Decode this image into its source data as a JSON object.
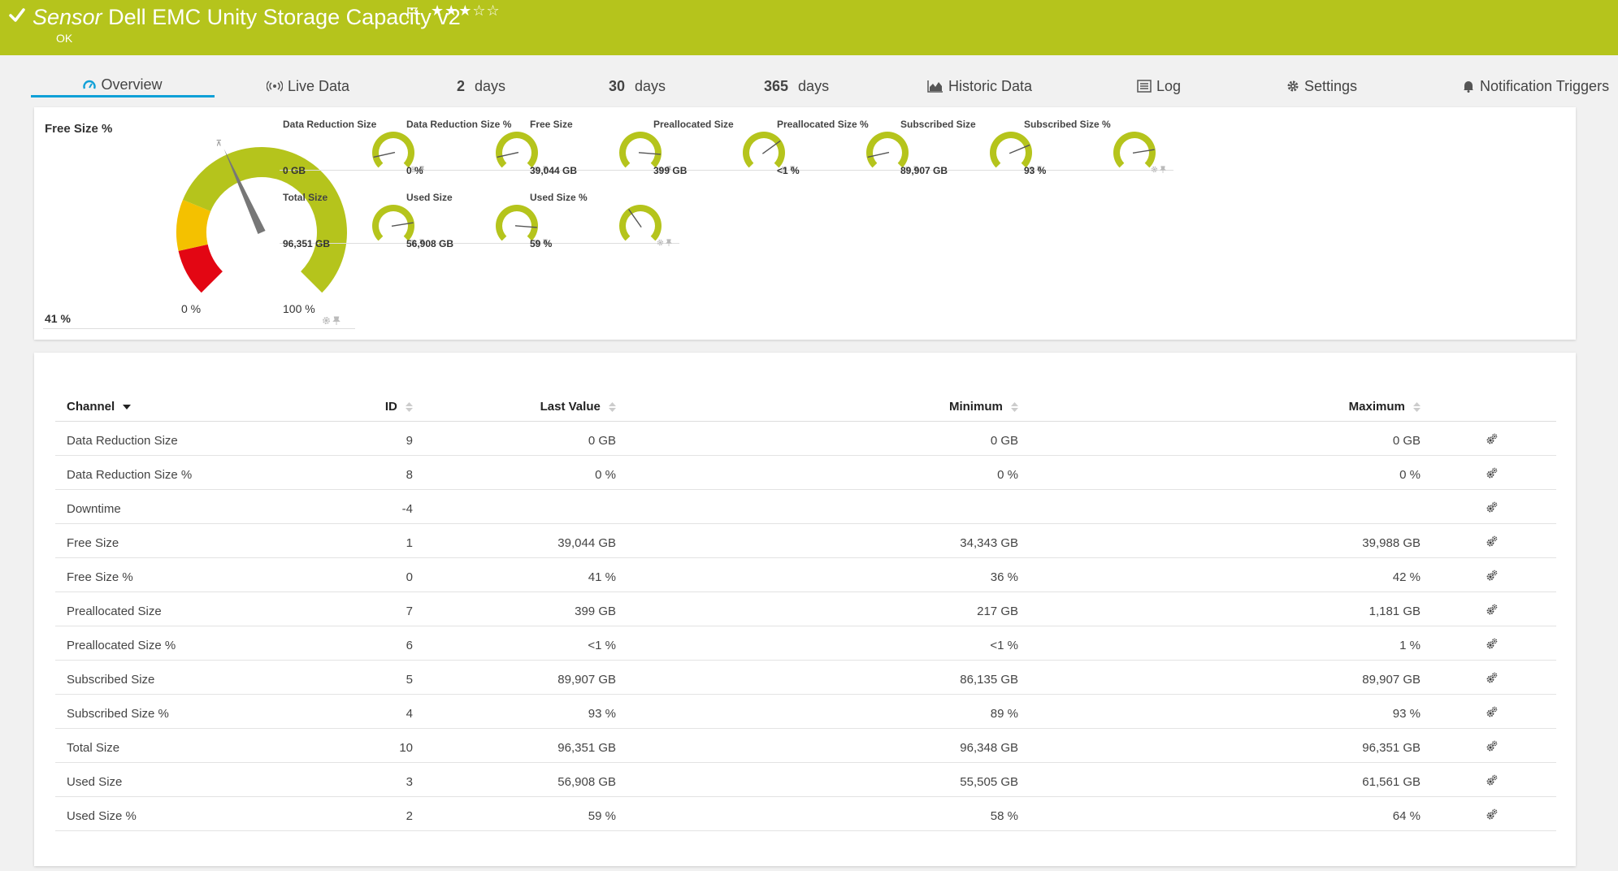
{
  "header": {
    "type_label": "Sensor",
    "name": "Dell EMC Unity Storage Capacity v2",
    "stars": "★★★☆☆",
    "status": "OK",
    "bg_color": "#b5c41c"
  },
  "tabs": [
    {
      "label": "Overview",
      "icon": "gauge-icon"
    },
    {
      "label": "Live Data",
      "icon": "broadcast-icon"
    },
    {
      "num": "2",
      "label": "days"
    },
    {
      "num": "30",
      "label": "days"
    },
    {
      "num": "365",
      "label": "days"
    },
    {
      "label": "Historic Data",
      "icon": "area-chart-icon"
    },
    {
      "label": "Log",
      "icon": "log-icon"
    },
    {
      "label": "Settings",
      "icon": "gear-icon"
    },
    {
      "label": "Notification Triggers",
      "icon": "bell-icon"
    }
  ],
  "primary_gauge": {
    "label": "Free Size %",
    "value": "41 %",
    "min_label": "0 %",
    "max_label": "100 %",
    "fraction": 0.41,
    "zones": {
      "red": "#e30613",
      "yellow": "#f4c100",
      "green": "#b5c41c"
    }
  },
  "mini_gauges": [
    {
      "label": "Data Reduction Size",
      "value": "0 GB",
      "fraction": 0.12
    },
    {
      "label": "Data Reduction Size %",
      "value": "0 %",
      "fraction": 0.12
    },
    {
      "label": "Free Size",
      "value": "39,044 GB",
      "fraction": 0.85
    },
    {
      "label": "Preallocated Size",
      "value": "399 GB",
      "fraction": 0.7
    },
    {
      "label": "Preallocated Size %",
      "value": "<1 %",
      "fraction": 0.12
    },
    {
      "label": "Subscribed Size",
      "value": "89,907 GB",
      "fraction": 0.75
    },
    {
      "label": "Subscribed Size %",
      "value": "93 %",
      "fraction": 0.8
    },
    {
      "label": "Total Size",
      "value": "96,351 GB",
      "fraction": 0.8
    },
    {
      "label": "Used Size",
      "value": "56,908 GB",
      "fraction": 0.85
    },
    {
      "label": "Used Size %",
      "value": "59 %",
      "fraction": 0.37
    }
  ],
  "table": {
    "headers": {
      "channel": "Channel",
      "id": "ID",
      "last_value": "Last Value",
      "minimum": "Minimum",
      "maximum": "Maximum"
    },
    "rows": [
      {
        "channel": "Data Reduction Size",
        "id": "9",
        "last": "0 GB",
        "min": "0 GB",
        "max": "0 GB"
      },
      {
        "channel": "Data Reduction Size %",
        "id": "8",
        "last": "0 %",
        "min": "0 %",
        "max": "0 %"
      },
      {
        "channel": "Downtime",
        "id": "-4",
        "last": "",
        "min": "",
        "max": ""
      },
      {
        "channel": "Free Size",
        "id": "1",
        "last": "39,044 GB",
        "min": "34,343 GB",
        "max": "39,988 GB"
      },
      {
        "channel": "Free Size %",
        "id": "0",
        "last": "41 %",
        "min": "36 %",
        "max": "42 %"
      },
      {
        "channel": "Preallocated Size",
        "id": "7",
        "last": "399 GB",
        "min": "217 GB",
        "max": "1,181 GB"
      },
      {
        "channel": "Preallocated Size %",
        "id": "6",
        "last": "<1 %",
        "min": "<1 %",
        "max": "1 %"
      },
      {
        "channel": "Subscribed Size",
        "id": "5",
        "last": "89,907 GB",
        "min": "86,135 GB",
        "max": "89,907 GB"
      },
      {
        "channel": "Subscribed Size %",
        "id": "4",
        "last": "93 %",
        "min": "89 %",
        "max": "93 %"
      },
      {
        "channel": "Total Size",
        "id": "10",
        "last": "96,351 GB",
        "min": "96,348 GB",
        "max": "96,351 GB"
      },
      {
        "channel": "Used Size",
        "id": "3",
        "last": "56,908 GB",
        "min": "55,505 GB",
        "max": "61,561 GB"
      },
      {
        "channel": "Used Size %",
        "id": "2",
        "last": "59 %",
        "min": "58 %",
        "max": "64 %"
      }
    ]
  }
}
